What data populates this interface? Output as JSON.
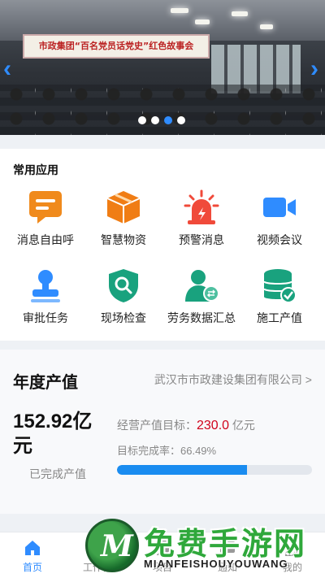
{
  "banner": {
    "screen_text": "市政集团“百名党员话党史”红色故事会",
    "prev": "‹",
    "next": "›",
    "dots": 4,
    "active_dot": 2
  },
  "apps": {
    "title": "常用应用",
    "items": [
      {
        "label": "消息自由呼",
        "icon": "message-icon",
        "color": "#f08a1c"
      },
      {
        "label": "智慧物资",
        "icon": "box-icon",
        "color": "#f07d14"
      },
      {
        "label": "预警消息",
        "icon": "alarm-icon",
        "color": "#f04a3a"
      },
      {
        "label": "视频会议",
        "icon": "video-icon",
        "color": "#2f8cff"
      },
      {
        "label": "审批任务",
        "icon": "stamp-icon",
        "color": "#2f8cff"
      },
      {
        "label": "现场检查",
        "icon": "inspect-icon",
        "color": "#19a27e"
      },
      {
        "label": "劳务数据汇总",
        "icon": "worker-icon",
        "color": "#19a27e"
      },
      {
        "label": "施工产值",
        "icon": "database-icon",
        "color": "#19a27e"
      }
    ]
  },
  "annual": {
    "heading": "年度产值",
    "company": "武汉市市政建设集团有限公司 >",
    "completed_value": "152.92亿元",
    "completed_label": "已完成产值",
    "target_label": "经营产值目标：",
    "target_value": "230.0",
    "target_unit": " 亿元",
    "rate_label": "目标完成率：66.49%",
    "progress": 0.6649
  },
  "tabbar": {
    "tabs": [
      {
        "label": "首页",
        "icon": "home-icon"
      },
      {
        "label": "工作台",
        "icon": "workbench-icon"
      },
      {
        "label": "项目",
        "icon": "project-icon"
      },
      {
        "label": "通知",
        "icon": "notice-icon"
      },
      {
        "label": "我的",
        "icon": "user-icon"
      }
    ],
    "active": 0
  },
  "watermark": {
    "logo_letter": "M",
    "title": "免费手游网",
    "subtitle": "MIANFEISHOUYOUWANG"
  },
  "colors": {
    "accent": "#2f8cff",
    "target_red": "#d0021b",
    "progress": "#1a8cf0"
  }
}
